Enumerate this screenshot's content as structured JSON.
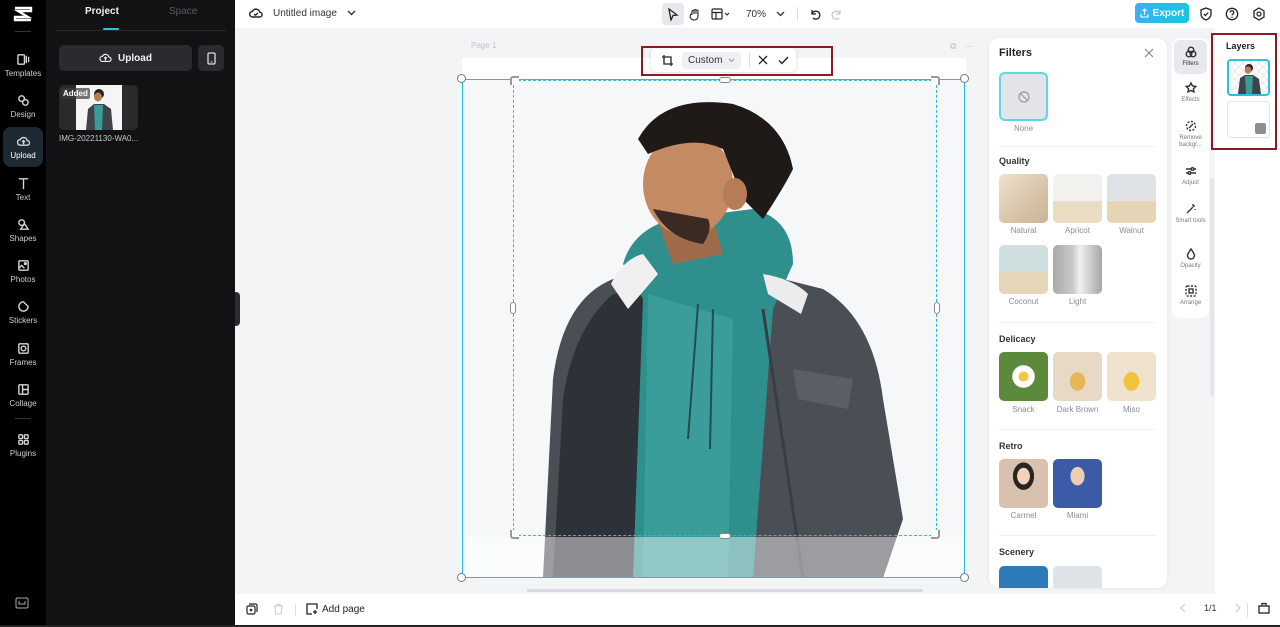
{
  "app": {
    "title": "Untitled image"
  },
  "rail": {
    "items": [
      {
        "label": "Templates",
        "icon": "templates-icon"
      },
      {
        "label": "Design",
        "icon": "design-icon"
      },
      {
        "label": "Upload",
        "icon": "upload-cloud-icon",
        "active": true
      },
      {
        "label": "Text",
        "icon": "text-icon"
      },
      {
        "label": "Shapes",
        "icon": "shapes-icon"
      },
      {
        "label": "Photos",
        "icon": "photos-icon"
      },
      {
        "label": "Stickers",
        "icon": "stickers-icon"
      },
      {
        "label": "Frames",
        "icon": "frames-icon"
      },
      {
        "label": "Collage",
        "icon": "collage-icon"
      },
      {
        "label": "Plugins",
        "icon": "plugins-icon"
      }
    ]
  },
  "panel": {
    "tabs": [
      "Project",
      "Space"
    ],
    "active_tab": "Project",
    "upload_label": "Upload",
    "assets": [
      {
        "name": "IMG-20221130-WA0...",
        "badge": "Added"
      }
    ]
  },
  "toolbar": {
    "zoom": "70%",
    "export_label": "Export"
  },
  "canvas": {
    "page_label": "Page 1",
    "crop_mode": "Custom"
  },
  "filters": {
    "title": "Filters",
    "none_label": "None",
    "sections": [
      {
        "title": "Quality",
        "items": [
          "Natural",
          "Apricot",
          "Walnut",
          "Coconut",
          "Light"
        ]
      },
      {
        "title": "Delicacy",
        "items": [
          "Snack",
          "Dark Brown",
          "Miso"
        ]
      },
      {
        "title": "Retro",
        "items": [
          "Carmel",
          "Miami"
        ]
      },
      {
        "title": "Scenery",
        "items": []
      }
    ]
  },
  "strip": {
    "items": [
      {
        "label": "Filters",
        "active": true
      },
      {
        "label": "Effects"
      },
      {
        "label": "Remove backgr..."
      },
      {
        "label": "Adjust"
      },
      {
        "label": "Smart tools"
      },
      {
        "label": "Opacity"
      },
      {
        "label": "Arrange"
      }
    ]
  },
  "layers": {
    "title": "Layers"
  },
  "bottom": {
    "add_page_label": "Add page",
    "page_indicator": "1/1"
  },
  "colors": {
    "accent": "#1fc7dc",
    "export_start": "#3ab0f5",
    "export_end": "#16c6e0",
    "highlight_outline": "#8b1a24"
  }
}
